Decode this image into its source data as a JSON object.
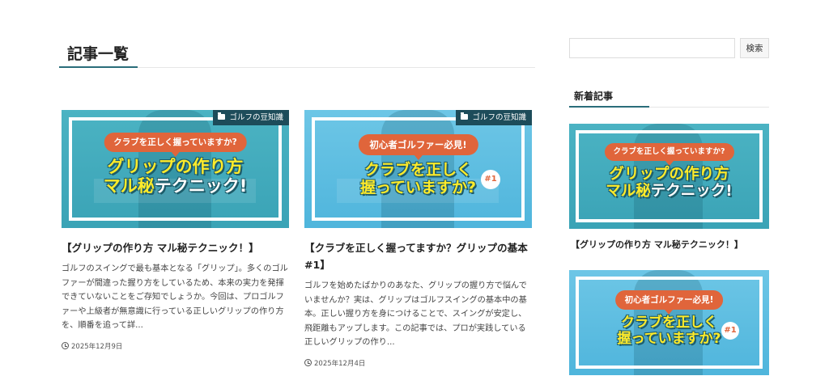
{
  "main": {
    "heading": "記事一覧",
    "posts": [
      {
        "category": "ゴルフの豆知識",
        "thumb_pill": "クラブを正しく握っていますか?",
        "thumb_line1": "グリップの作り方",
        "thumb_line2_y": "マル秘",
        "thumb_line2_w": "テクニック!",
        "title": "【グリップの作り方 マル秘テクニック！】",
        "excerpt": "ゴルフのスイングで最も基本となる「グリップ」。多くのゴルファーが間違った握り方をしているため、本来の実力を発揮できていないことをご存知でしょうか。今回は、プロゴルファーや上級者が無意識に行っている正しいグリップの作り方を、順番を追って詳...",
        "date": "2025年12月9日"
      },
      {
        "category": "ゴルフの豆知識",
        "thumb_pill": "初心者ゴルファー必見!",
        "thumb_line1": "クラブを正しく",
        "thumb_line2": "握っていますか?",
        "thumb_num": "#1",
        "title": "【クラブを正しく握ってますか？グリップの基本#1】",
        "excerpt": "ゴルフを始めたばかりのあなた、グリップの握り方で悩んでいませんか？実は、グリップはゴルフスイングの基本中の基本。正しい握り方を身につけることで、スイングが安定し、飛距離もアップします。この記事では、プロが実践している正しいグリップの作り...",
        "date": "2025年12月4日"
      }
    ]
  },
  "sidebar": {
    "search": {
      "value": "",
      "placeholder": "",
      "button_label": "検索"
    },
    "recent_heading": "新着記事",
    "recent_posts": [
      {
        "thumb_pill": "クラブを正しく握っていますか?",
        "thumb_line1": "グリップの作り方",
        "thumb_line2_y": "マル秘",
        "thumb_line2_w": "テクニック!",
        "title": "【グリップの作り方 マル秘テクニック！】"
      },
      {
        "thumb_pill": "初心者ゴルファー必見!",
        "thumb_line1": "クラブを正しく",
        "thumb_line2": "握っていますか?",
        "thumb_num": "#1"
      }
    ]
  },
  "colors": {
    "accent": "#2a6d7a",
    "pill": "#e0653b",
    "headline_yellow": "#ffeb2a",
    "category_bg": "#1d4c5a"
  },
  "icons": {
    "category": "folder-icon",
    "date": "clock-icon"
  }
}
